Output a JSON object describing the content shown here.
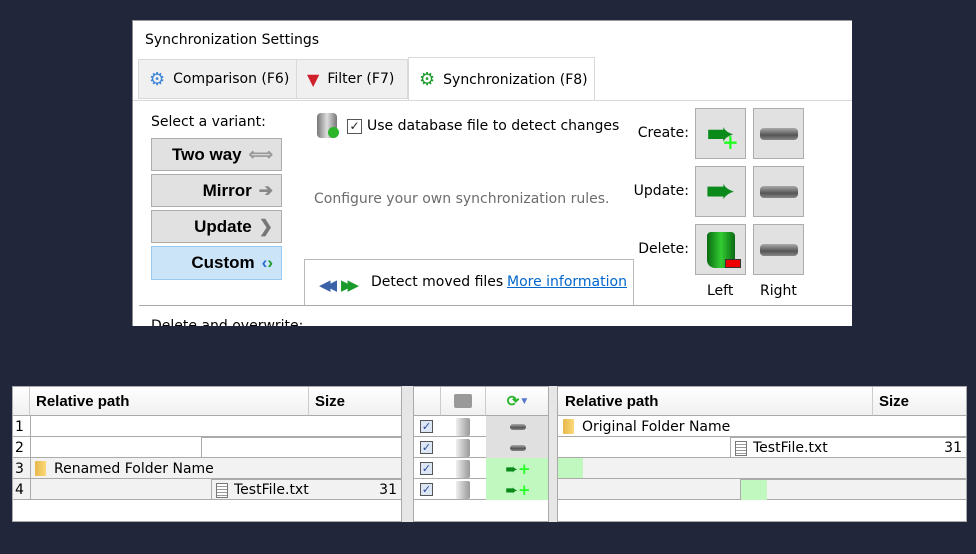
{
  "dialog": {
    "title": "Synchronization Settings",
    "tabs": [
      {
        "label": "Comparison (F6)",
        "icon": "gear-blue-icon"
      },
      {
        "label": "Filter (F7)",
        "icon": "funnel-icon"
      },
      {
        "label": "Synchronization (F8)",
        "icon": "gear-green-icon",
        "active": true
      }
    ],
    "variant_label": "Select a variant:",
    "variants": [
      {
        "label": "Two way",
        "icon": "double-arrow-icon"
      },
      {
        "label": "Mirror",
        "icon": "arrow-right-icon"
      },
      {
        "label": "Update",
        "icon": "chevron-right-icon"
      },
      {
        "label": "Custom",
        "icon": "custom-arrows-icon",
        "selected": true
      }
    ],
    "use_database": {
      "label": "Use database file to detect changes",
      "checked": true
    },
    "description": "Configure your own synchronization rules.",
    "detect_moved": {
      "label": "Detect moved files",
      "link": "More information"
    },
    "rules": [
      {
        "label": "Create:",
        "left": "create-icon",
        "right": "none-icon"
      },
      {
        "label": "Update:",
        "left": "update-icon",
        "right": "none-icon"
      },
      {
        "label": "Delete:",
        "left": "recycle-icon",
        "right": "none-icon"
      }
    ],
    "col_left": "Left",
    "col_right": "Right",
    "next_section": "Delete and overwrite:"
  },
  "grid": {
    "left": {
      "headers": [
        "Relative path",
        "Size"
      ],
      "rows": [
        {
          "num": "1",
          "path": "",
          "size": ""
        },
        {
          "num": "2",
          "path": "",
          "size": ""
        },
        {
          "num": "3",
          "path": "Renamed Folder Name",
          "size": "",
          "type": "folder"
        },
        {
          "num": "4",
          "path": "TestFile.txt",
          "size": "31",
          "type": "file"
        }
      ]
    },
    "middle": {
      "rows": [
        {
          "checked": true,
          "action": "none"
        },
        {
          "checked": true,
          "action": "none"
        },
        {
          "checked": true,
          "action": "create-left"
        },
        {
          "checked": true,
          "action": "create-left"
        }
      ]
    },
    "right": {
      "headers": [
        "Relative path",
        "Size"
      ],
      "rows": [
        {
          "path": "Original Folder Name",
          "size": "",
          "type": "folder"
        },
        {
          "path": "TestFile.txt",
          "size": "31",
          "type": "file"
        },
        {
          "path": "",
          "size": ""
        },
        {
          "path": "",
          "size": ""
        }
      ]
    }
  },
  "colors": {
    "background": "#22263b",
    "selected_variant": "#cce4f7",
    "create_row": "#c0f8c0",
    "link": "#0066cc"
  }
}
